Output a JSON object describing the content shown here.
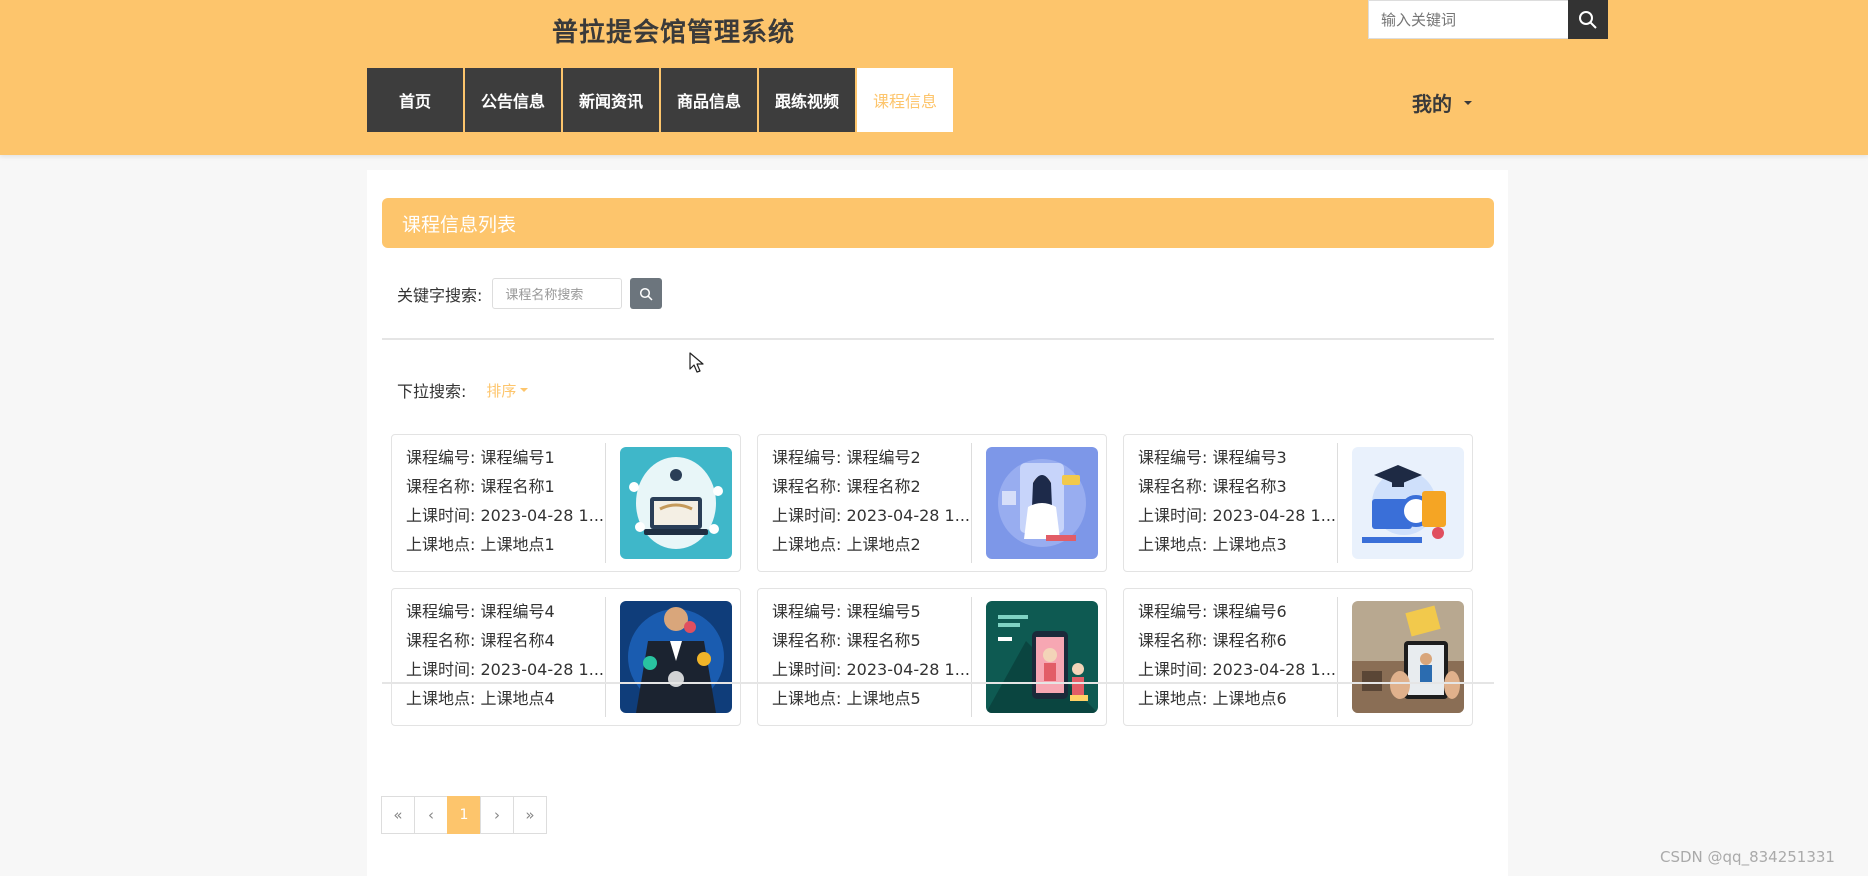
{
  "header": {
    "title": "普拉提会馆管理系统",
    "search_placeholder": "输入关键词",
    "nav": [
      {
        "label": "首页"
      },
      {
        "label": "公告信息"
      },
      {
        "label": "新闻资讯"
      },
      {
        "label": "商品信息"
      },
      {
        "label": "跟练视频"
      },
      {
        "label": "课程信息",
        "active": true
      }
    ],
    "my_menu": "我的"
  },
  "panel": {
    "title": "课程信息列表",
    "keyword_label": "关键字搜索:",
    "keyword_placeholder": "课程名称搜索",
    "dropdown_label": "下拉搜索:",
    "sort_label": "排序"
  },
  "courses": [
    {
      "code": "课程编号: 课程编号1",
      "name": "课程名称: 课程名称1",
      "time": "上课时间: 2023-04-28 1...",
      "place": "上课地点: 上课地点1",
      "thumb": "online-learning-laptop"
    },
    {
      "code": "课程编号: 课程编号2",
      "name": "课程名称: 课程名称2",
      "time": "上课时间: 2023-04-28 1...",
      "place": "上课地点: 上课地点2",
      "thumb": "teacher-screen"
    },
    {
      "code": "课程编号: 课程编号3",
      "name": "课程名称: 课程名称3",
      "time": "上课时间: 2023-04-28 1...",
      "place": "上课地点: 上课地点3",
      "thumb": "graduation-study"
    },
    {
      "code": "课程编号: 课程编号4",
      "name": "课程名称: 课程名称4",
      "time": "上课时间: 2023-04-28 1...",
      "place": "上课地点: 上课地点4",
      "thumb": "businessman-icons"
    },
    {
      "code": "课程编号: 课程编号5",
      "name": "课程名称: 课程名称5",
      "time": "上课时间: 2023-04-28 1...",
      "place": "上课地点: 上课地点5",
      "thumb": "phone-lesson"
    },
    {
      "code": "课程编号: 课程编号6",
      "name": "课程名称: 课程名称6",
      "time": "上课时间: 2023-04-28 1...",
      "place": "上课地点: 上课地点6",
      "thumb": "tablet-classroom"
    }
  ],
  "pagination": {
    "first": "«",
    "prev": "‹",
    "current": "1",
    "next": "›",
    "last": "»"
  },
  "watermark": "CSDN @qq_834251331",
  "colors": {
    "accent": "#fdc56c",
    "nav_bg": "#3d3d3d",
    "search_btn": "#6c757d"
  }
}
